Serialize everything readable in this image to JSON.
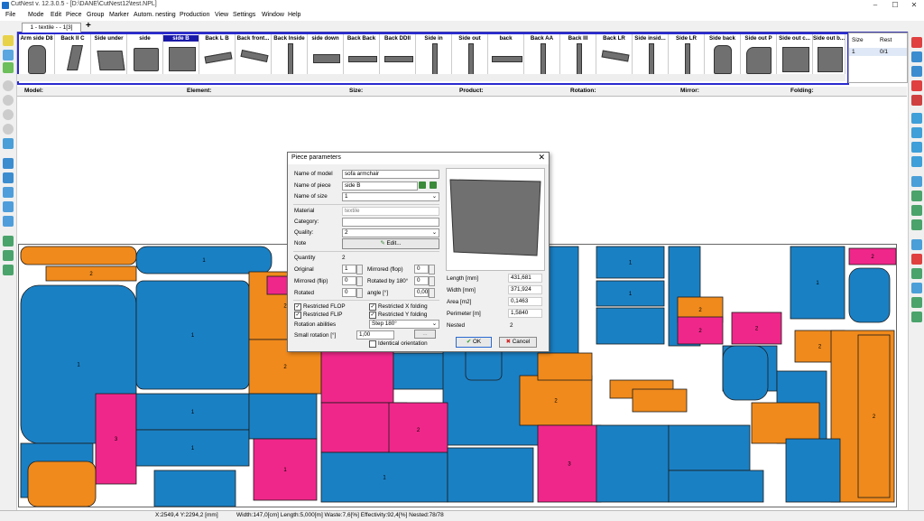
{
  "window": {
    "title": "CutNest v. 12.3.0.5 - [D:\\DANE\\CutNest12\\test.NPL]"
  },
  "menu": [
    "File",
    "Mode",
    "Edit",
    "Piece",
    "Group",
    "Marker",
    "Autom. nesting",
    "Production",
    "View",
    "Settings",
    "Window",
    "Help"
  ],
  "tabs": {
    "active": "1 - textile -  - 1[3]",
    "add": "+"
  },
  "pieces": [
    "Arm side D8",
    "Back II C",
    "Side under",
    "side",
    "side B",
    "Back L B",
    "Back front...",
    "Back Inside",
    "side down",
    "Back Back",
    "Back DDII",
    "Side in",
    "Side out",
    "back",
    "Back AA",
    "Back III",
    "Back LR",
    "Side insid...",
    "Side LR",
    "Side back",
    "Side out P",
    "Side out c...",
    "Side out b..."
  ],
  "selected_piece": "side B",
  "size_table": {
    "col_size": "Size",
    "col_rest": "Rest",
    "row_size": "1",
    "row_rest": "0/1"
  },
  "columns": [
    "Model:",
    "Element:",
    "Size:",
    "Product:",
    "Rotation:",
    "Mirror:",
    "Folding:"
  ],
  "status": {
    "coords": "X:2549,4  Y:2294,2 [mm]",
    "summary": "Width:147,0[cm]  Length:5,000[m]  Waste:7,6[%]  Effectivity:92,4[%]  Nested:78/78"
  },
  "dialog": {
    "title": "Piece parameters",
    "close": "✕",
    "name_of_model_label": "Name of model",
    "name_of_model": "sofa armchair",
    "name_of_piece_label": "Name of piece",
    "name_of_piece": "side B",
    "name_of_size_label": "Name of size",
    "name_of_size": "1",
    "material_label": "Material",
    "material": "textile",
    "category_label": "Category:",
    "category": "",
    "quality_label": "Quality:",
    "quality": "2",
    "note_label": "Note",
    "edit_button": "Edit...",
    "quantity_label": "Quantity",
    "quantity": "2",
    "original_label": "Original",
    "original": "1",
    "mirrored_flop_label": "Mirrored (flop)",
    "mirrored_flop": "0",
    "mirrored_flip_label": "Mirrored (flip)",
    "mirrored_flip": "0",
    "rotated180_label": "Rotated by 180°",
    "rotated180": "0",
    "rotated_label": "Rotated",
    "rotated": "0",
    "angle_label": "angle [°]",
    "angle": "0,00",
    "restricted_flop": "Restricted FLOP",
    "restricted_flip": "Restricted FLIP",
    "restricted_x": "Restricted X folding",
    "restricted_y": "Restricted Y folding",
    "rotation_abilities_label": "Rotation abilities",
    "rotation_abilities": "Step 180°",
    "small_rotation_label": "Small rotation [°]",
    "small_rotation": "1,00",
    "identical_orientation": "Identical orientation",
    "length_label": "Length [mm]",
    "length": "431,681",
    "width_label": "Width [mm]",
    "width": "371,924",
    "area_label": "Area [m2]",
    "area": "0,1463",
    "perimeter_label": "Perimeter [m]",
    "perimeter": "1,5840",
    "nested_label": "Nested",
    "nested": "2",
    "ok": "OK",
    "cancel": "Cancel"
  },
  "colors": {
    "blue": "#1a80c4",
    "orange": "#f08a1c",
    "magenta": "#f0278a",
    "accent": "#2a2ad0"
  }
}
